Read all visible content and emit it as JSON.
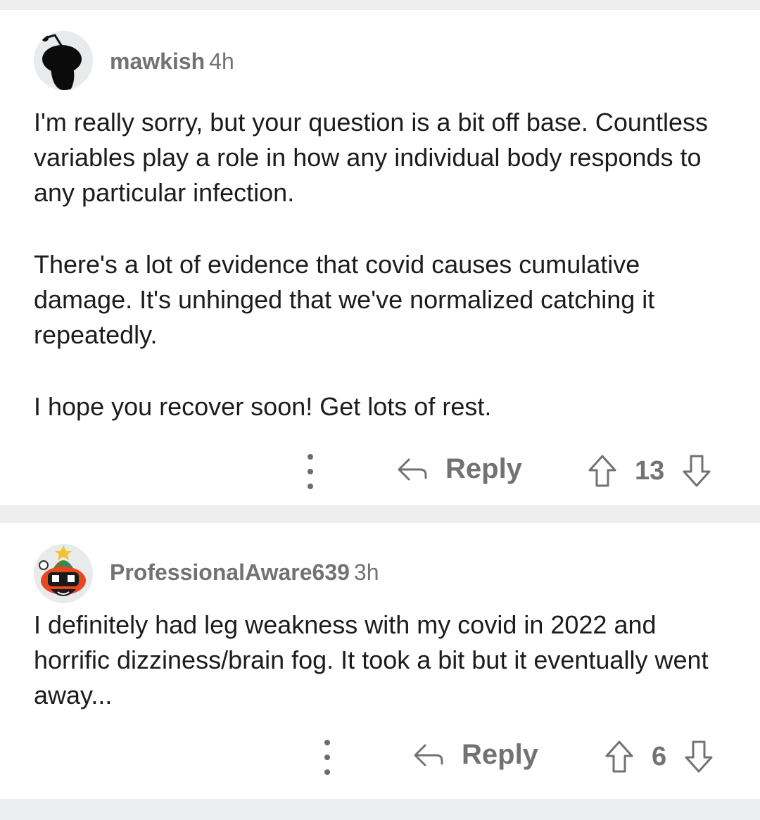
{
  "comments": [
    {
      "username": "mawkish",
      "age": "4h",
      "avatar_icon": "snoo-avatar-black-icon",
      "paragraphs": [
        "I'm really sorry, but your question is a bit off base. Countless variables play a role in how any individual body responds to any particular infection.",
        "There's a lot of evidence that covid causes cumulative damage. It's unhinged that we've normalized catching it repeatedly.",
        "I hope you recover soon! Get lots of rest."
      ],
      "reply_label": "Reply",
      "score": "13"
    },
    {
      "username": "ProfessionalAware639",
      "age": "3h",
      "avatar_icon": "snoo-avatar-holiday-icon",
      "paragraphs": [
        "I definitely had leg weakness with my covid in 2022 and horrific dizziness/brain fog. It took a bit but it eventually went away..."
      ],
      "reply_label": "Reply",
      "score": "6"
    }
  ],
  "colors": {
    "page_background": "#edeef0",
    "card_background": "#ffffff",
    "meta_text": "#707274",
    "body_text": "#1c1c1c"
  }
}
